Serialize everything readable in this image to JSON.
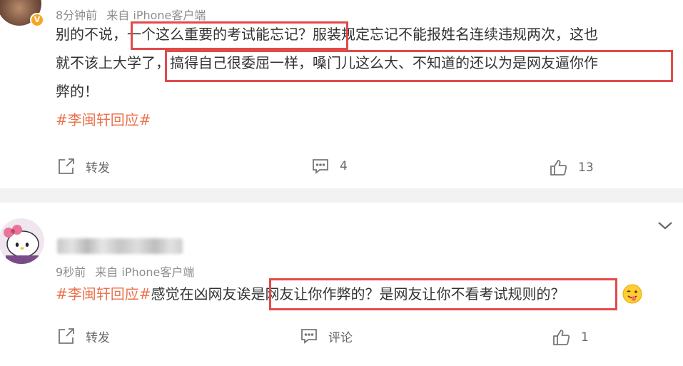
{
  "colors": {
    "accent": "#eb7350",
    "highlight_box": "#e24a4a",
    "divider": "#f2f2f2",
    "muted": "#8d8d8d"
  },
  "comment1": {
    "meta": {
      "time": "8分钟前",
      "source": "来自 iPhone客户端"
    },
    "verified_badge": "V",
    "line1": {
      "a": "别的不说，",
      "b": "一个这么重要的考试能忘记？",
      "c": "服装规定忘记不能报姓名连续违规两次，这也"
    },
    "line2": {
      "a": "就不该上大学了",
      "b": "，搞得自己很委屈一样，嗓门儿这么大、不知道的还以为是网友逼你作"
    },
    "line3": "弊的！",
    "hashtag": "#李闽轩回应#",
    "actions": {
      "repost": "转发",
      "comments": "4",
      "likes": "13"
    }
  },
  "comment2": {
    "meta": {
      "time": "9秒前",
      "source": "来自 iPhone客户端"
    },
    "text": {
      "hashtag": "#李闽轩回应#",
      "a": "感觉在凶网友诶",
      "b": "是网友让你作弊的？是网友让你不看考试规则的？"
    },
    "emoji": "tongue-out-face-icon",
    "actions": {
      "repost": "转发",
      "comment": "评论",
      "likes": "1"
    }
  }
}
